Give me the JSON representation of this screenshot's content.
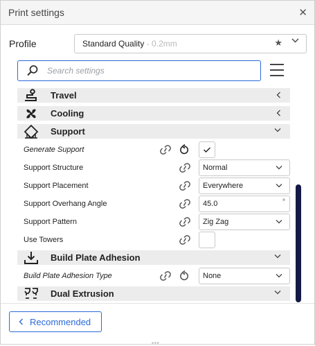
{
  "window": {
    "title": "Print settings"
  },
  "profile": {
    "label": "Profile",
    "name": "Standard Quality",
    "sub": " - 0.2mm"
  },
  "search": {
    "placeholder": "Search settings"
  },
  "categories": {
    "travel": "Travel",
    "cooling": "Cooling",
    "support": "Support",
    "adhesion": "Build Plate Adhesion",
    "dual": "Dual Extrusion"
  },
  "settings": {
    "generate_support": {
      "label": "Generate Support",
      "checked": true
    },
    "support_structure": {
      "label": "Support Structure",
      "value": "Normal"
    },
    "support_placement": {
      "label": "Support Placement",
      "value": "Everywhere"
    },
    "overhang_angle": {
      "label": "Support Overhang Angle",
      "value": "45.0",
      "unit": "°"
    },
    "support_pattern": {
      "label": "Support Pattern",
      "value": "Zig Zag"
    },
    "use_towers": {
      "label": "Use Towers",
      "checked": false
    },
    "adhesion_type": {
      "label": "Build Plate Adhesion Type",
      "value": "None"
    }
  },
  "footer": {
    "recommended_label": "Recommended"
  },
  "colors": {
    "accent": "#2a6ad9",
    "scrollbar": "#141a45"
  }
}
